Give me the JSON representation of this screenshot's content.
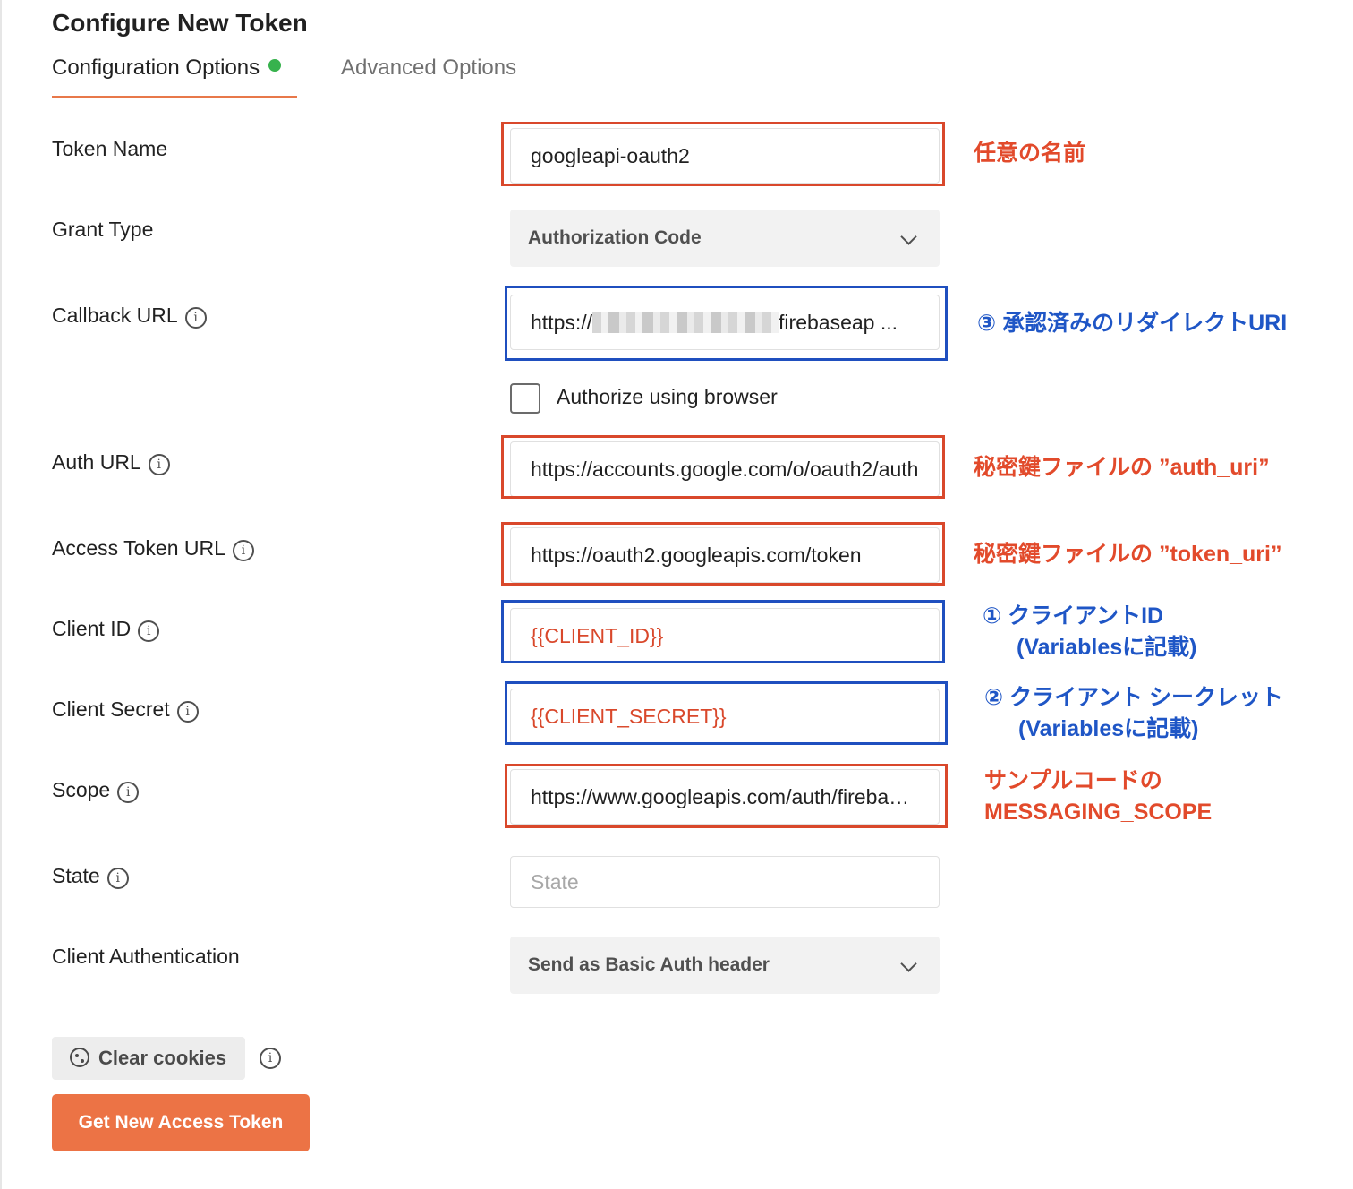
{
  "title": "Configure New Token",
  "tabs": {
    "configuration": "Configuration Options",
    "advanced": "Advanced Options"
  },
  "fields": {
    "token_name": {
      "label": "Token Name",
      "value": "googleapi-oauth2"
    },
    "grant_type": {
      "label": "Grant Type",
      "value": "Authorization Code"
    },
    "callback_url": {
      "label": "Callback URL",
      "value_prefix": "https://",
      "value_suffix": "firebaseap",
      "ellipsis": "..."
    },
    "auth_url": {
      "label": "Auth URL",
      "value": "https://accounts.google.com/o/oauth2/auth"
    },
    "access_token_url": {
      "label": "Access Token URL",
      "value": "https://oauth2.googleapis.com/token"
    },
    "client_id": {
      "label": "Client ID",
      "value": "{{CLIENT_ID}}"
    },
    "client_secret": {
      "label": "Client Secret",
      "value": "{{CLIENT_SECRET}}"
    },
    "scope": {
      "label": "Scope",
      "value": "https://www.googleapis.com/auth/firebase.messaging"
    },
    "state": {
      "label": "State",
      "placeholder": "State"
    },
    "client_authentication": {
      "label": "Client Authentication",
      "value": "Send as Basic Auth header"
    }
  },
  "checkbox": {
    "label": "Authorize using browser",
    "checked": false
  },
  "buttons": {
    "clear_cookies": "Clear cookies",
    "get_token": "Get New Access Token"
  },
  "icons": {
    "info": "info-icon",
    "cookie": "cookie-icon",
    "chevron": "chevron-down-icon"
  },
  "annotations": {
    "token_name": "任意の名前",
    "callback_url": "③ 承認済みのリダイレクトURI",
    "auth_url": "秘密鍵ファイルの ”auth_uri”",
    "access_token_url": "秘密鍵ファイルの ”token_uri”",
    "client_id_line1": "① クライアントID",
    "client_id_line2": "(Variablesに記載)",
    "client_secret_line1": "② クライアント シークレット",
    "client_secret_line2": "(Variablesに記載)",
    "scope_line1": "サンプルコードの",
    "scope_line2": "MESSAGING_SCOPE"
  },
  "colors": {
    "accent": "#ec7345",
    "annotation_red": "#e24a2b",
    "annotation_blue": "#1f56c6",
    "variable_text": "#d9482b",
    "tab_dot": "#37b24d"
  }
}
